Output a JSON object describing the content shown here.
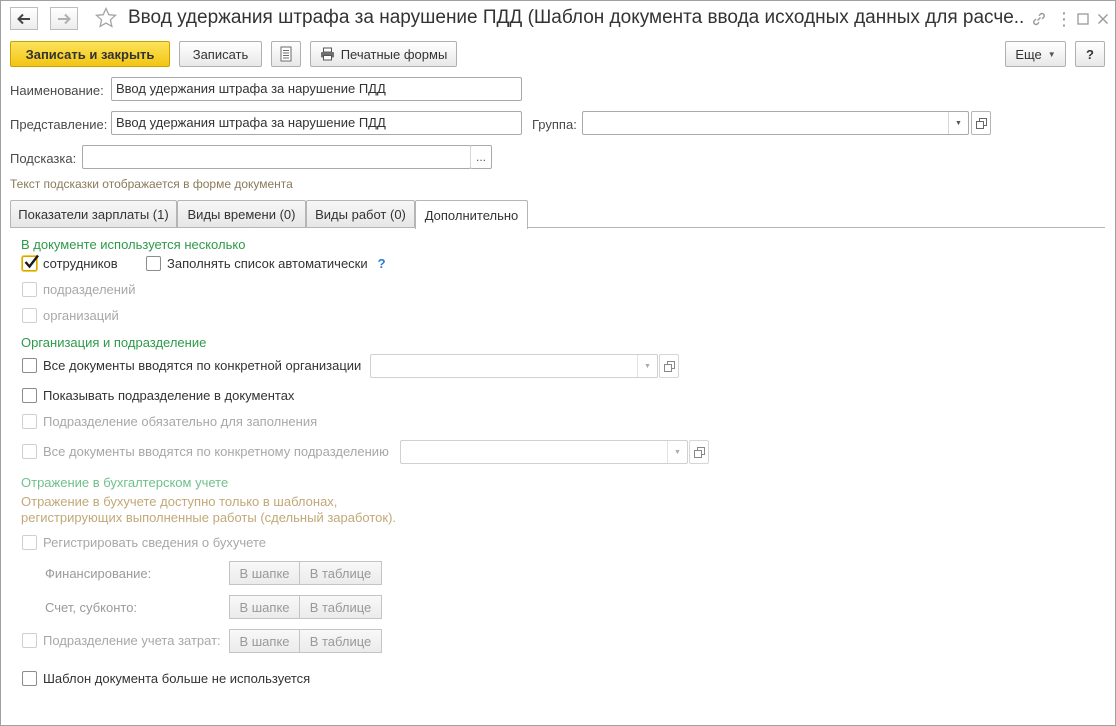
{
  "window": {
    "title": "Ввод удержания штрафа за нарушение ПДД (Шаблон документа ввода исходных данных для расче..."
  },
  "toolbar": {
    "save_close": "Записать и закрыть",
    "save": "Записать",
    "print_forms": "Печатные формы",
    "more": "Еще",
    "help": "?"
  },
  "form": {
    "name_label": "Наименование:",
    "name_value": "Ввод удержания штрафа за нарушение ПДД",
    "repr_label": "Представление:",
    "repr_value": "Ввод удержания штрафа за нарушение ПДД",
    "group_label": "Группа:",
    "group_value": "",
    "hint_label": "Подсказка:",
    "hint_value": "",
    "hint_note": "Текст подсказки отображается в форме документа",
    "ellipsis": "..."
  },
  "tabs": [
    {
      "label": "Показатели зарплаты (1)"
    },
    {
      "label": "Виды времени (0)"
    },
    {
      "label": "Виды работ (0)"
    },
    {
      "label": "Дополнительно"
    }
  ],
  "additional": {
    "multi_title": "В документе используется несколько",
    "employees": "сотрудников",
    "autofill": "Заполнять список автоматически",
    "autofill_help": "?",
    "departments": "подразделений",
    "organizations": "организаций",
    "org_title": "Организация и подразделение",
    "all_docs_org": "Все документы вводятся по конкретной организации",
    "show_dept": "Показывать подразделение в документах",
    "dept_required": "Подразделение обязательно для заполнения",
    "all_docs_dept": "Все документы вводятся по конкретному подразделению",
    "acc_title": "Отражение в бухгалтерском учете",
    "acc_note_1": "Отражение в бухучете доступно только в шаблонах,",
    "acc_note_2": "регистрирующих выполненные работы (сдельный заработок).",
    "register_acc": "Регистрировать сведения о бухучете",
    "financing": "Финансирование:",
    "account": "Счет, субконто:",
    "cost_dept": "Подразделение учета затрат:",
    "in_header": "В шапке",
    "in_table": "В таблице",
    "template_unused": "Шаблон документа больше не используется"
  }
}
